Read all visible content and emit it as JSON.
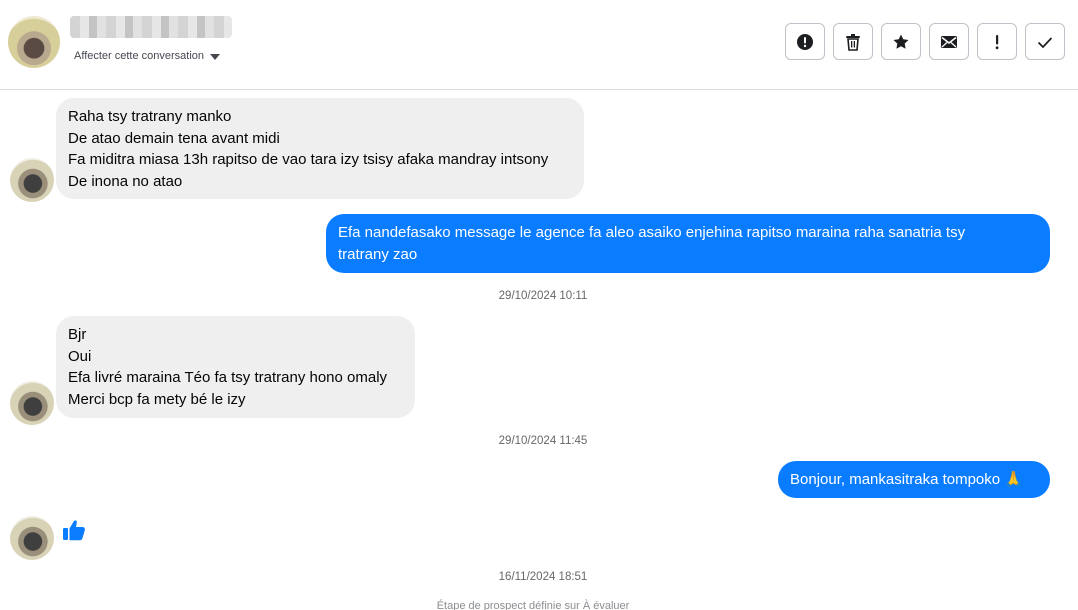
{
  "header": {
    "assign_label": "Affecter cette conversation",
    "tools": [
      {
        "name": "report-spam",
        "symbol": "alert-circle"
      },
      {
        "name": "delete",
        "symbol": "trash"
      },
      {
        "name": "star",
        "symbol": "star"
      },
      {
        "name": "mark-unread",
        "symbol": "envelope"
      },
      {
        "name": "mark-important",
        "symbol": "exclamation"
      },
      {
        "name": "mark-done",
        "symbol": "check"
      }
    ]
  },
  "messages": [
    {
      "direction": "in",
      "lines": [
        "Raha tsy tratrany manko",
        "De atao demain tena avant midi",
        "Fa miditra miasa 13h rapitso de vao tara izy tsisy afaka mandray intsony",
        "De inona no atao"
      ]
    },
    {
      "direction": "out",
      "lines": [
        "Efa nandefasako message le agence fa aleo asaiko enjehina rapitso maraina raha sanatria tsy",
        "tratrany zao"
      ]
    },
    {
      "timestamp": "29/10/2024 10:11"
    },
    {
      "direction": "in",
      "lines": [
        "Bjr",
        "Oui",
        "Efa livré maraina Téo fa tsy tratrany hono omaly",
        "Merci bcp fa mety bé le izy"
      ]
    },
    {
      "timestamp": "29/10/2024 11:45"
    },
    {
      "direction": "out",
      "lines": [
        "Bonjour, mankasitraka tompoko 🙏"
      ]
    },
    {
      "direction": "in",
      "like": true
    },
    {
      "timestamp": "16/11/2024 18:51"
    }
  ],
  "footer_note": "Étape de prospect définie sur À évaluer",
  "colors": {
    "outgoing": "#0a7cff",
    "incoming": "#efeff0",
    "like": "#0a7cff"
  }
}
